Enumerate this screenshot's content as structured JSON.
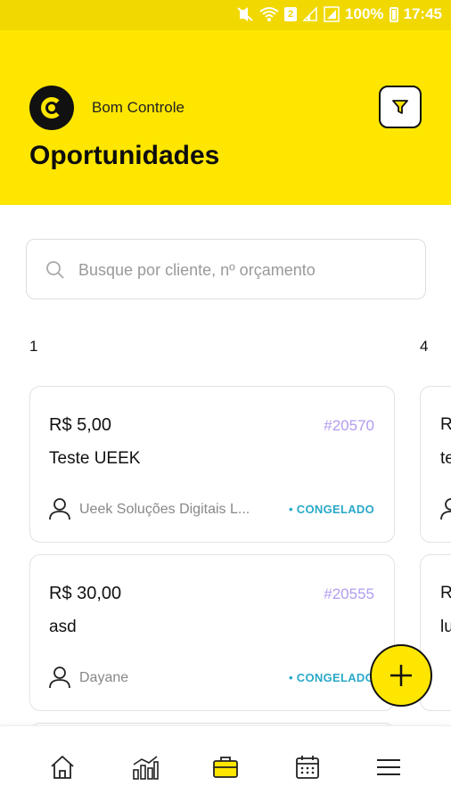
{
  "status_bar": {
    "battery": "100%",
    "time": "17:45",
    "sim_badge": "2",
    "icons": [
      "mute-vibrate-icon",
      "wifi-icon",
      "sim-badge-icon",
      "signal-icon",
      "signal-icon-2",
      "battery-icon"
    ]
  },
  "header": {
    "brand": "Bom Controle",
    "title": "Oportunidades",
    "logo_icon": "brand-logo-icon",
    "filter_icon": "filter-icon"
  },
  "search": {
    "placeholder": "Busque por cliente, nº orçamento",
    "value": ""
  },
  "columns": [
    {
      "count": "1"
    },
    {
      "count": "4"
    }
  ],
  "cards": [
    {
      "price": "R$ 5,00",
      "code": "#20570",
      "name": "Teste UEEK",
      "client": "Ueek Soluções Digitais L...",
      "status": "CONGELADO"
    },
    {
      "price": "R$ 30,00",
      "code": "#20555",
      "name": "asd",
      "client": "Dayane",
      "status": "CONGELADO"
    }
  ],
  "peek_cards": [
    {
      "line1": "R",
      "line2": "te"
    },
    {
      "line1": "R",
      "line2": "lu"
    }
  ],
  "fab": {
    "icon": "plus-icon"
  },
  "bottom_nav": [
    {
      "icon": "home-icon",
      "active": false
    },
    {
      "icon": "chart-icon",
      "active": false
    },
    {
      "icon": "briefcase-icon",
      "active": true
    },
    {
      "icon": "calendar-icon",
      "active": false
    },
    {
      "icon": "menu-icon",
      "active": false
    }
  ],
  "colors": {
    "accent": "#ffe600",
    "status_bar": "#f0d800",
    "status_congelado": "#29a9c9",
    "code": "#b39cf0"
  }
}
